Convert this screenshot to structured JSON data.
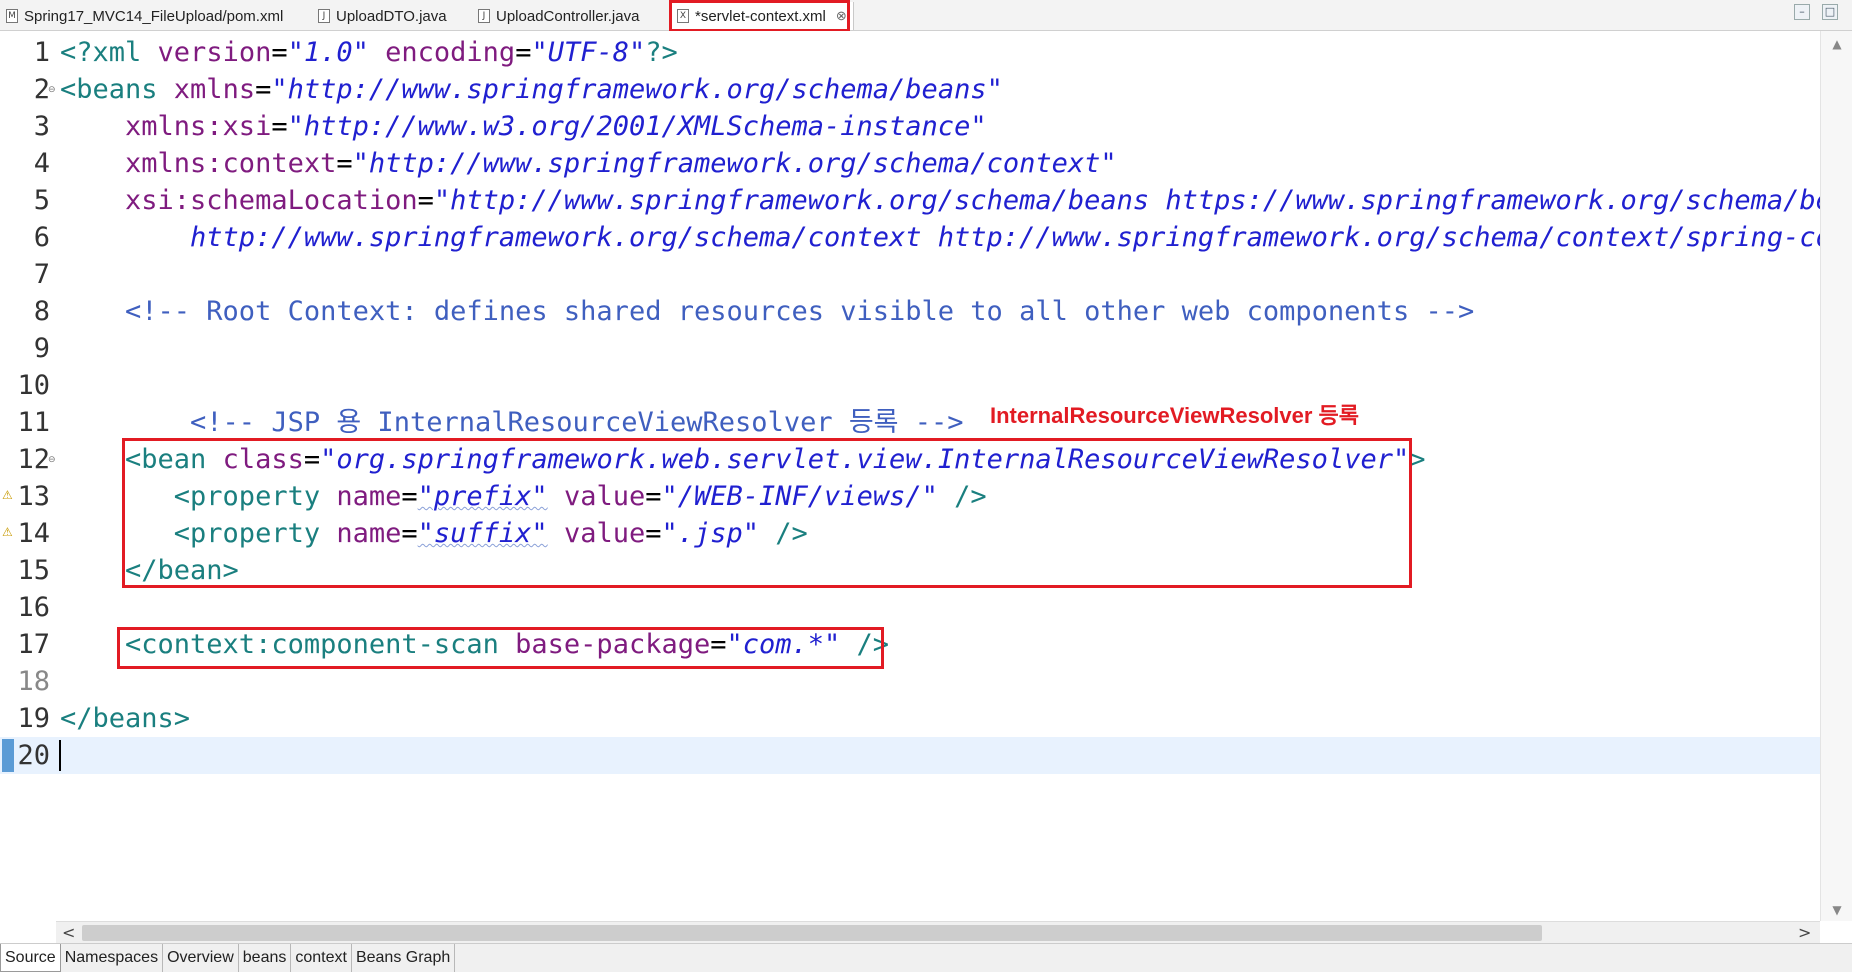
{
  "tabs": [
    {
      "label": "Spring17_MVC14_FileUpload/pom.xml",
      "icon": "M"
    },
    {
      "label": "UploadDTO.java",
      "icon": "J"
    },
    {
      "label": "UploadController.java",
      "icon": "J"
    },
    {
      "label": "*servlet-context.xml",
      "icon": "X",
      "close": "⊗"
    }
  ],
  "lines": [
    {
      "n": "1"
    },
    {
      "n": "2"
    },
    {
      "n": "3"
    },
    {
      "n": "4"
    },
    {
      "n": "5"
    },
    {
      "n": "6"
    },
    {
      "n": "7"
    },
    {
      "n": "8"
    },
    {
      "n": "9"
    },
    {
      "n": "10"
    },
    {
      "n": "11"
    },
    {
      "n": "12"
    },
    {
      "n": "13"
    },
    {
      "n": "14"
    },
    {
      "n": "15"
    },
    {
      "n": "16"
    },
    {
      "n": "17"
    },
    {
      "n": "18"
    },
    {
      "n": "19"
    },
    {
      "n": "20"
    }
  ],
  "code": {
    "l1": {
      "a": "<?xml ",
      "b": "version",
      "c": "=",
      "d": "\"1.0\"",
      "e": " encoding",
      "f": "=",
      "g": "\"UTF-8\"",
      "h": "?>"
    },
    "l2": {
      "a": "<beans ",
      "b": "xmlns",
      "c": "=",
      "d": "\"http://www.springframework.org/schema/beans\""
    },
    "l3": {
      "b": "    xmlns:xsi",
      "c": "=",
      "d": "\"http://www.w3.org/2001/XMLSchema-instance\""
    },
    "l4": {
      "b": "    xmlns:context",
      "c": "=",
      "d": "\"http://www.springframework.org/schema/context\""
    },
    "l5": {
      "b": "    xsi:schemaLocation",
      "c": "=",
      "d": "\"http://www.springframework.org/schema/beans https://www.springframework.org/schema/bea"
    },
    "l6": {
      "d": "        http://www.springframework.org/schema/context http://www.springframework.org/schema/context/spring-con"
    },
    "l8": {
      "a": "    <!-- Root Context: defines shared resources visible to all other web components -->"
    },
    "l11": {
      "a": "        <!-- JSP 용 InternalResourceViewResolver 등록 -->"
    },
    "l12": {
      "a": "    <bean ",
      "b": "class",
      "c": "=",
      "d": "\"org.springframework.web.servlet.view.InternalResourceViewResolver\"",
      "e": ">"
    },
    "l13": {
      "a": "       <property ",
      "b": "name",
      "c": "=",
      "d": "\"prefix\"",
      "e": " value",
      "f": "=",
      "g": "\"/WEB-INF/views/\"",
      "h": " />"
    },
    "l14": {
      "a": "       <property ",
      "b": "name",
      "c": "=",
      "d": "\"suffix\"",
      "e": " value",
      "f": "=",
      "g": "\".jsp\"",
      "h": " />"
    },
    "l15": {
      "a": "    </bean>"
    },
    "l17": {
      "a": "    <context:component-scan ",
      "b": "base-package",
      "c": "=",
      "d": "\"com.*\"",
      "e": " />"
    },
    "l19": {
      "a": "</beans>"
    }
  },
  "annotation": "InternalResourceViewResolver 등록",
  "bottom_tabs": [
    "Source",
    "Namespaces",
    "Overview",
    "beans",
    "context",
    "Beans Graph"
  ],
  "scroll": {
    "left_arrow": "<",
    "right_arrow": ">",
    "up_arrow": "▲",
    "down_arrow": "▼"
  },
  "window_buttons": {
    "minimize": "–",
    "maximize": "□"
  },
  "colors": {
    "annotation_red": "#e21b23",
    "tag": "#1a7f7f",
    "attr": "#7f1b7f",
    "value": "#2020d0",
    "comment": "#3f5fbf"
  }
}
